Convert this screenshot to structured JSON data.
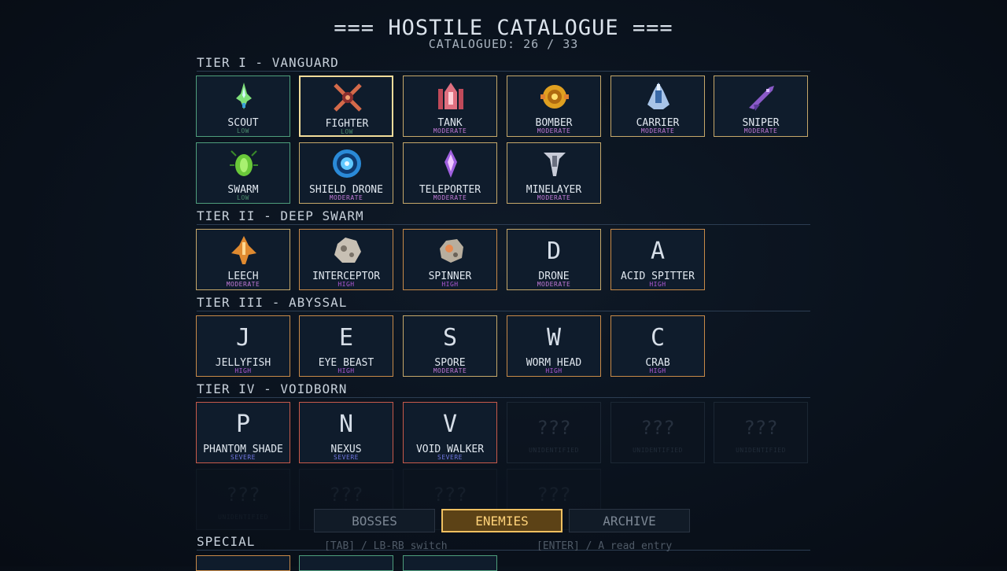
{
  "title": "=== HOSTILE CATALOGUE ===",
  "subtitle": "CATALOGUED:  26 / 33",
  "tiers": [
    {
      "label": "TIER I  -  VANGUARD"
    },
    {
      "label": "TIER II  -  DEEP SWARM"
    },
    {
      "label": "TIER III  -  ABYSSAL"
    },
    {
      "label": "TIER IV  -  VOIDBORN"
    }
  ],
  "special_label": "SPECIAL",
  "cards": [
    {
      "name": "SCOUT",
      "threat": "LOW",
      "icon": "scout-ship-icon"
    },
    {
      "name": "FIGHTER",
      "threat": "LOW",
      "icon": "fighter-x-icon"
    },
    {
      "name": "TANK",
      "threat": "MODERATE",
      "icon": "tank-ship-icon"
    },
    {
      "name": "BOMBER",
      "threat": "MODERATE",
      "icon": "bomber-gear-icon"
    },
    {
      "name": "CARRIER",
      "threat": "MODERATE",
      "icon": "carrier-ship-icon"
    },
    {
      "name": "SNIPER",
      "threat": "MODERATE",
      "icon": "sniper-ship-icon"
    },
    {
      "name": "SWARM",
      "threat": "LOW",
      "icon": "swarm-bug-icon"
    },
    {
      "name": "SHIELD DRONE",
      "threat": "MODERATE",
      "icon": "shield-drone-icon"
    },
    {
      "name": "TELEPORTER",
      "threat": "MODERATE",
      "icon": "teleporter-crystal-icon"
    },
    {
      "name": "MINELAYER",
      "threat": "MODERATE",
      "icon": "minelayer-ship-icon"
    },
    {
      "name": "LEECH",
      "threat": "MODERATE",
      "icon": "leech-ship-icon"
    },
    {
      "name": "INTERCEPTOR",
      "threat": "HIGH",
      "icon": "interceptor-rock-icon"
    },
    {
      "name": "SPINNER",
      "threat": "HIGH",
      "icon": "spinner-rock-icon"
    },
    {
      "name": "DRONE",
      "threat": "MODERATE",
      "letter": "D"
    },
    {
      "name": "ACID SPITTER",
      "threat": "HIGH",
      "letter": "A"
    },
    {
      "name": "JELLYFISH",
      "threat": "HIGH",
      "letter": "J"
    },
    {
      "name": "EYE BEAST",
      "threat": "HIGH",
      "letter": "E"
    },
    {
      "name": "SPORE",
      "threat": "MODERATE",
      "letter": "S"
    },
    {
      "name": "WORM HEAD",
      "threat": "HIGH",
      "letter": "W"
    },
    {
      "name": "CRAB",
      "threat": "HIGH",
      "letter": "C"
    },
    {
      "name": "PHANTOM SHADE",
      "threat": "SEVERE",
      "letter": "P"
    },
    {
      "name": "NEXUS",
      "threat": "SEVERE",
      "letter": "N"
    },
    {
      "name": "VOID WALKER",
      "threat": "SEVERE",
      "letter": "V"
    }
  ],
  "unknown": {
    "mark": "???",
    "label": "UNIDENTIFIED"
  },
  "tabs": [
    "BOSSES",
    "ENEMIES",
    "ARCHIVE"
  ],
  "active_tab": "ENEMIES",
  "hint_switch": "[TAB] / LB-RB  switch",
  "hint_read": "[ENTER] / A  read entry",
  "colors": {
    "accent": "#f0c060",
    "low": "#4e9e7c",
    "moderate": "#c6a86a",
    "high": "#c88a48",
    "severe": "#c85a4a"
  }
}
